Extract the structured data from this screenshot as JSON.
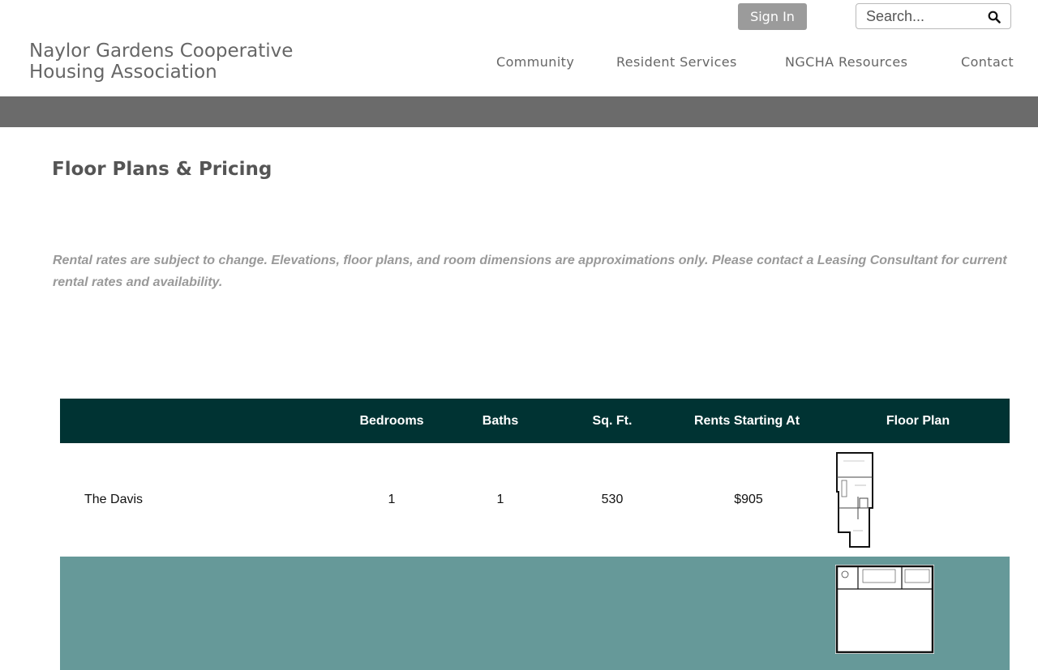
{
  "header": {
    "sign_in_label": "Sign In",
    "search_placeholder": "Search...",
    "site_title": "Naylor Gardens Cooperative Housing Association",
    "nav": [
      "Community",
      "Resident Services",
      "NGCHA Resources",
      "Contact"
    ]
  },
  "main": {
    "title": "Floor Plans & Pricing",
    "disclaimer": "Rental rates are subject to change. Elevations, floor plans, and room dimensions are approximations only. Please contact a Leasing Consultant for current rental rates and availability."
  },
  "table": {
    "columns": [
      "",
      "Bedrooms",
      "Baths",
      "Sq. Ft.",
      "Rents Starting At",
      "Floor Plan"
    ],
    "rows": [
      {
        "name": "The Davis",
        "bedrooms": "1",
        "baths": "1",
        "sqft": "530",
        "rent": "$905"
      },
      {
        "name": "",
        "bedrooms": "",
        "baths": "",
        "sqft": "",
        "rent": ""
      }
    ]
  },
  "colors": {
    "header_band": "#6b6b6b",
    "table_header": "#003333",
    "row_alt": "#669999",
    "sign_in_bg": "#9b9b9b"
  },
  "icons": [
    "search-icon",
    "floor-plan-image"
  ]
}
